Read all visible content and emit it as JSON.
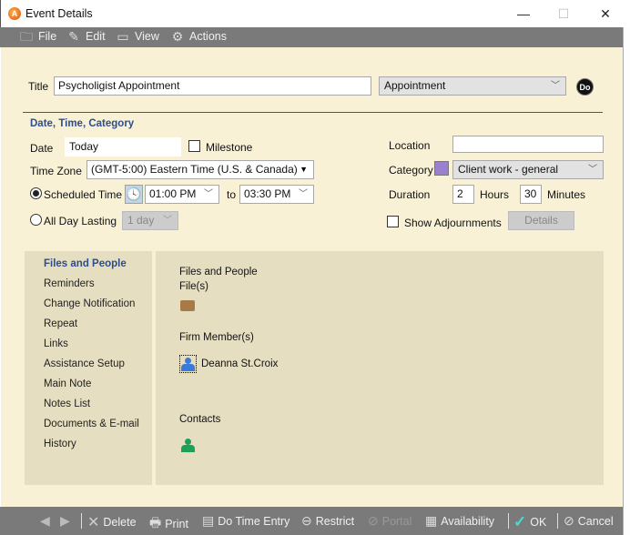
{
  "window": {
    "title": "Event Details",
    "minimize": "—",
    "maximize": "☐",
    "close": "✕"
  },
  "menu": [
    {
      "label": "File",
      "icon": "folder-icon"
    },
    {
      "label": "Edit",
      "icon": "edit-icon"
    },
    {
      "label": "View",
      "icon": "monitor-icon"
    },
    {
      "label": "Actions",
      "icon": "gear-icon"
    }
  ],
  "form": {
    "title_label": "Title",
    "title_value": "Psycholigist Appointment",
    "type_value": "Appointment",
    "do_label": "Do",
    "section_title": "Date, Time, Category",
    "date_label": "Date",
    "date_value": "Today",
    "milestone_label": "Milestone",
    "timezone_label": "Time Zone",
    "timezone_value": "(GMT-5:00) Eastern Time (U.S. & Canada)",
    "scheduled_label": "Scheduled Time",
    "start_time": "01:00 PM",
    "to_label": "to",
    "end_time": "03:30 PM",
    "allday_label": "All Day Lasting",
    "allday_value": "1 day",
    "location_label": "Location",
    "location_value": "",
    "category_label": "Category",
    "category_value": "Client work - general",
    "category_color": "#9b80d0",
    "duration_label": "Duration",
    "hours_value": "2",
    "hours_label": "Hours",
    "minutes_value": "30",
    "minutes_label": "Minutes",
    "adjourn_label": "Show Adjournments",
    "details_label": "Details"
  },
  "sidebar": {
    "items": [
      {
        "label": "Files and People",
        "active": true
      },
      {
        "label": "Reminders"
      },
      {
        "label": "Change Notification"
      },
      {
        "label": "Repeat"
      },
      {
        "label": "Links"
      },
      {
        "label": "Assistance Setup"
      },
      {
        "label": "Main Note"
      },
      {
        "label": "Notes List"
      },
      {
        "label": "Documents & E-mail"
      },
      {
        "label": "History"
      }
    ]
  },
  "files_people": {
    "heading": "Files and People",
    "files_label": "File(s)",
    "members_label": "Firm Member(s)",
    "member_name": "Deanna St.Croix",
    "contacts_label": "Contacts"
  },
  "footer": {
    "delete": "Delete",
    "print": "Print",
    "time_entry": "Do Time Entry",
    "restrict": "Restrict",
    "portal": "Portal",
    "availability": "Availability",
    "ok": "OK",
    "cancel": "Cancel"
  }
}
